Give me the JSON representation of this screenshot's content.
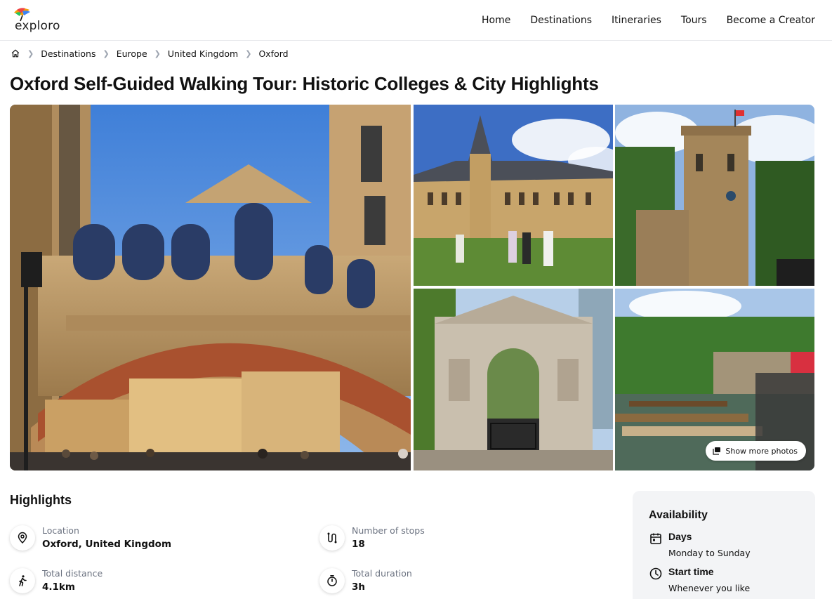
{
  "brand": {
    "name": "exploro"
  },
  "nav": {
    "items": [
      "Home",
      "Destinations",
      "Itineraries",
      "Tours",
      "Become a Creator"
    ]
  },
  "breadcrumb": {
    "items": [
      "Destinations",
      "Europe",
      "United Kingdom",
      "Oxford"
    ]
  },
  "page": {
    "title": "Oxford Self-Guided Walking Tour: Historic Colleges & City Highlights"
  },
  "gallery": {
    "more_photos_label": "Show more photos"
  },
  "highlights": {
    "title": "Highlights",
    "items": [
      {
        "label": "Location",
        "value": "Oxford, United Kingdom",
        "icon": "location-pin-icon"
      },
      {
        "label": "Number of stops",
        "value": "18",
        "icon": "route-icon"
      },
      {
        "label": "Total distance",
        "value": "4.1km",
        "icon": "walking-icon"
      },
      {
        "label": "Total duration",
        "value": "3h",
        "icon": "stopwatch-icon"
      }
    ]
  },
  "availability": {
    "title": "Availability",
    "days_label": "Days",
    "days_value": "Monday to Sunday",
    "start_label": "Start time",
    "start_value": "Whenever you like"
  },
  "colors": {
    "text": "#111111",
    "muted": "#6b7280",
    "panel": "#f3f4f6",
    "border": "#e5e7eb"
  }
}
